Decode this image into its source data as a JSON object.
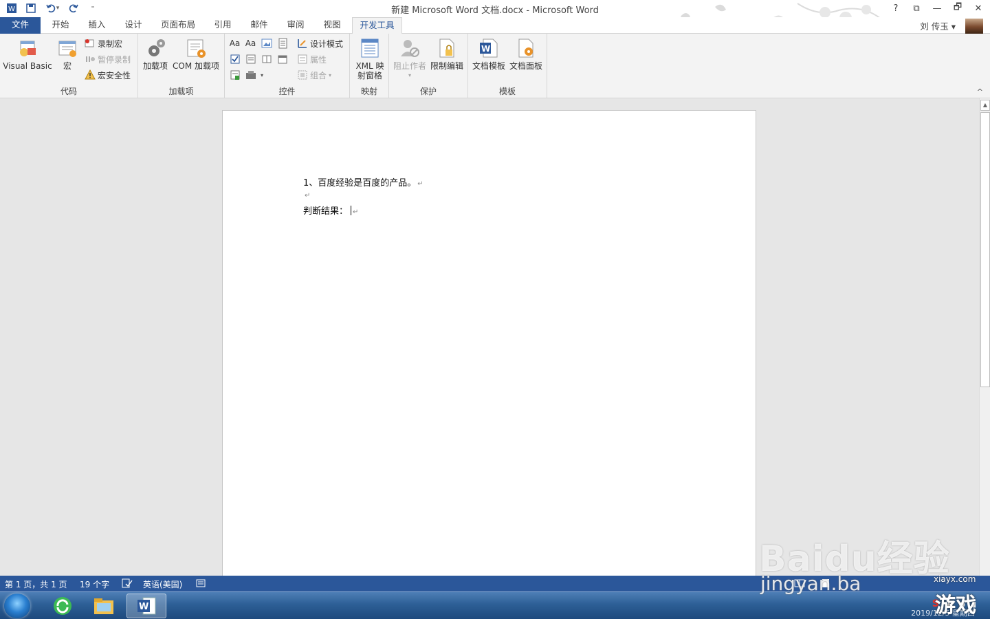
{
  "window": {
    "title": "新建 Microsoft Word 文档.docx - Microsoft Word",
    "help": "?",
    "ribbon_display": "⧉",
    "minimize": "—",
    "restore": "🗗",
    "close": "✕"
  },
  "qat": {
    "undo_arrow": "▾",
    "customize": "⁼"
  },
  "tabs": [
    {
      "label": "文件"
    },
    {
      "label": "开始"
    },
    {
      "label": "插入"
    },
    {
      "label": "设计"
    },
    {
      "label": "页面布局"
    },
    {
      "label": "引用"
    },
    {
      "label": "邮件"
    },
    {
      "label": "审阅"
    },
    {
      "label": "视图"
    },
    {
      "label": "开发工具"
    }
  ],
  "user": {
    "name": "刘 传玉 ▾"
  },
  "ribbon": {
    "code": {
      "label": "代码",
      "visual_basic": "Visual Basic",
      "macros": "宏",
      "record_macro": "录制宏",
      "pause_recording": "暂停录制",
      "macro_security": "宏安全性"
    },
    "addins": {
      "label": "加载项",
      "addins": "加载项",
      "com_addins": "COM 加载项"
    },
    "controls": {
      "label": "控件",
      "design_mode": "设计模式",
      "properties": "属性",
      "group": "组合"
    },
    "mapping": {
      "label": "映射",
      "xml_pane_line1": "XML 映",
      "xml_pane_line2": "射窗格"
    },
    "protect": {
      "label": "保护",
      "block_authors": "阻止作者",
      "restrict_editing": "限制编辑"
    },
    "templates": {
      "label": "模板",
      "document_template": "文档模板",
      "document_panel": "文档面板"
    },
    "collapse": "^"
  },
  "document": {
    "line1": "1、百度经验是百度的产品。",
    "line3": "判断结果："
  },
  "statusbar": {
    "page": "第 1 页，共 1 页",
    "words": "19 个字",
    "language": "英语(美国)"
  },
  "watermark": {
    "baidu": "Baidu经验",
    "jingyan": "jingyan.ba",
    "site": "xiayx.com",
    "game": "游戏"
  },
  "clock": {
    "date": "2019/12/5 星期四"
  }
}
